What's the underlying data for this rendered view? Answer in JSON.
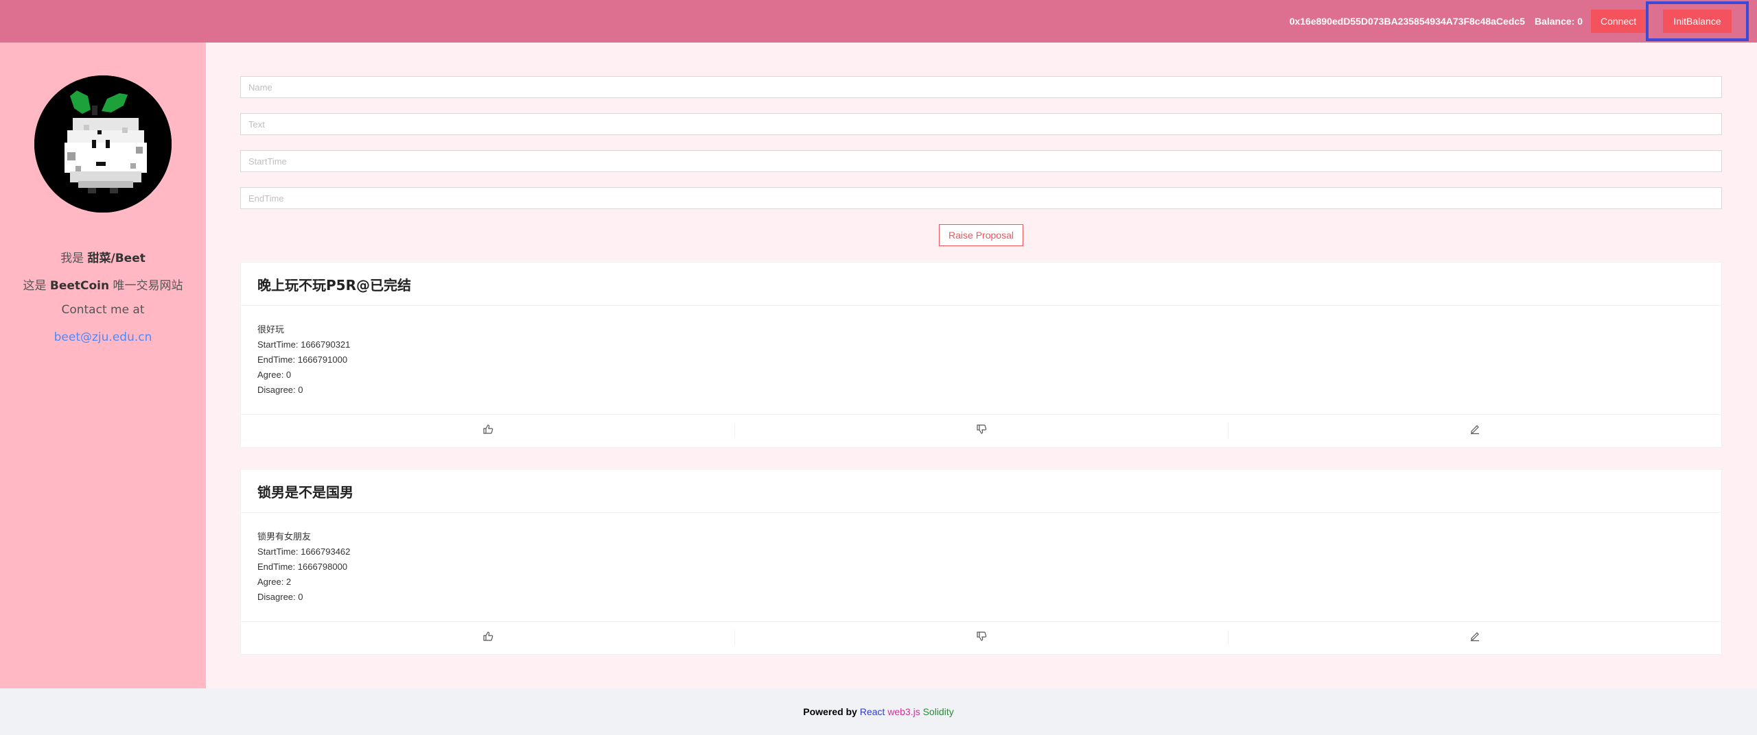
{
  "header": {
    "account": "0x16e890edD55D073BA235854934A73F8c48aCedc5",
    "balance": "Balance: 0",
    "connect_label": "Connect",
    "init_balance_label": "InitBalance"
  },
  "sidebar": {
    "avatar_icon": "pixel-turnip-avatar",
    "intro_prefix": "我是",
    "intro_name": "甜菜/Beet",
    "site_prefix": "这是",
    "site_name": "BeetCoin",
    "site_suffix": "唯一交易网站",
    "contact": "Contact me at",
    "email": "beet@zju.edu.cn"
  },
  "form": {
    "name_placeholder": "Name",
    "text_placeholder": "Text",
    "start_placeholder": "StartTime",
    "end_placeholder": "EndTime",
    "raise_label": "Raise Proposal"
  },
  "proposals": [
    {
      "title": "晚上玩不玩P5R@已完结",
      "text": "很好玩",
      "start": "StartTime: 1666790321",
      "end": "EndTime: 1666791000",
      "agree": "Agree: 0",
      "disagree": "Disagree: 0"
    },
    {
      "title": "锁男是不是国男",
      "text": "锁男有女朋友",
      "start": "StartTime: 1666793462",
      "end": "EndTime: 1666798000",
      "agree": "Agree: 2",
      "disagree": "Disagree: 0"
    }
  ],
  "footer": {
    "powered": "Powered by",
    "react": "React",
    "web3": "web3.js",
    "solidity": "Solidity"
  },
  "colors": {
    "header": "#dd7090",
    "sidebar": "#ffb8c4",
    "accent": "#f4525c",
    "highlight": "#3a49d6"
  }
}
